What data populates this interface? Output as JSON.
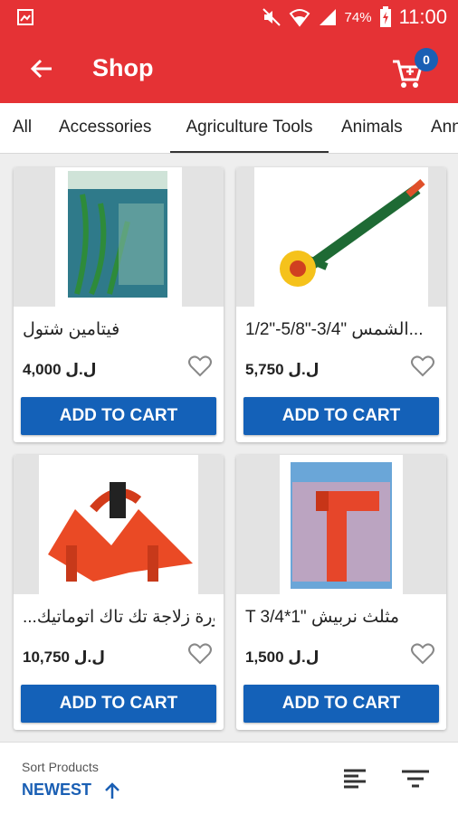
{
  "status_bar": {
    "battery": "74%",
    "time": "11:00"
  },
  "app_bar": {
    "title": "Shop",
    "cart_count": "0"
  },
  "tabs": [
    {
      "label": "All"
    },
    {
      "label": "Accessories"
    },
    {
      "label": "Agriculture Tools",
      "active": true
    },
    {
      "label": "Animals"
    },
    {
      "label": "Ann"
    }
  ],
  "products": [
    {
      "name": "فيتامين شتول",
      "price": "4,000 ل.ل",
      "button": "ADD TO CART"
    },
    {
      "name": "1/2\"-5/8\"-3/4\" الشمس...",
      "price": "5,750 ل.ل",
      "button": "ADD TO CART"
    },
    {
      "name": "...ورة زلاجة تك تاك اتوماتيك",
      "price": "10,750 ل.ل",
      "button": "ADD TO CART"
    },
    {
      "name": "T 3/4*1\" مثلث نربيش",
      "price": "1,500 ل.ل",
      "button": "ADD TO CART"
    }
  ],
  "bottom": {
    "sort_label": "Sort Products",
    "sort_value": "NEWEST"
  },
  "colors": {
    "primary": "#e53235",
    "accent": "#1461b8"
  },
  "icons": [
    "mute-icon",
    "wifi-icon",
    "signal-icon",
    "battery-icon",
    "back-arrow-icon",
    "cart-icon",
    "heart-icon",
    "arrow-up-icon",
    "list-view-icon",
    "filter-icon"
  ]
}
